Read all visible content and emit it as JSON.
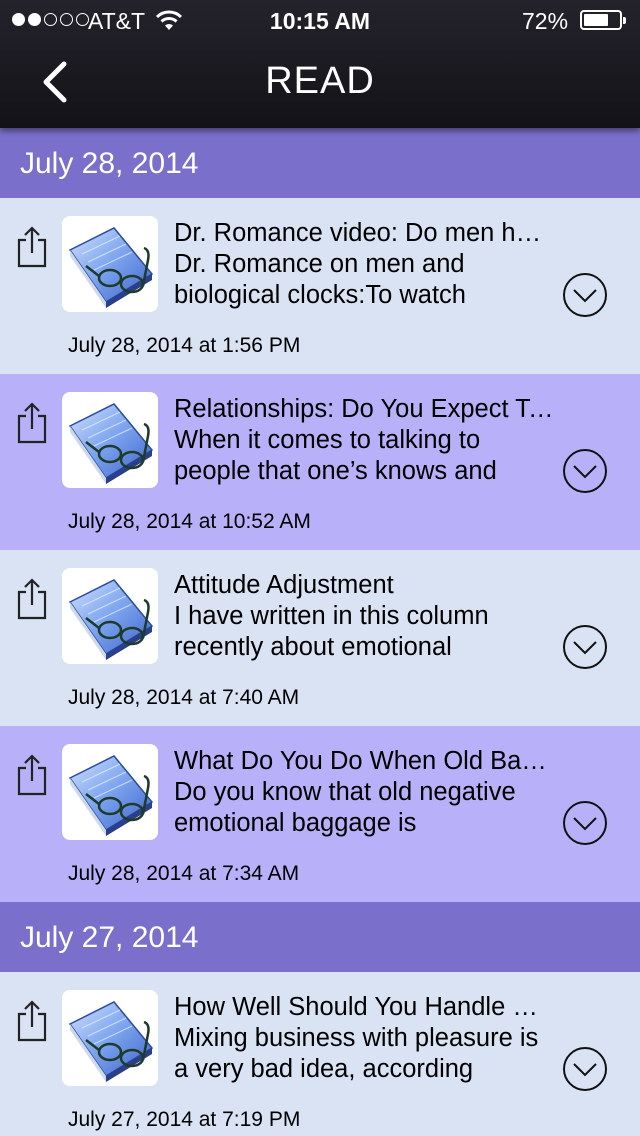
{
  "status_bar": {
    "carrier": "AT&T",
    "time": "10:15 AM",
    "battery": "72%",
    "battery_level": 0.72,
    "icons": [
      "signal-dots",
      "wifi-icon",
      "battery-icon"
    ]
  },
  "nav": {
    "title": "READ",
    "back_icon": "chevron-left-icon"
  },
  "colors": {
    "nav_bar": "#1b1a21",
    "date_header": "#7a6fcb",
    "row_light": "#d9e3f3",
    "row_purple": "#b8b0f9"
  },
  "sections": [
    {
      "date": "July 28, 2014",
      "items": [
        {
          "title": "Dr. Romance video: Do men have a biological clock?",
          "excerpt": "Dr. Romance on men and biological clocks:To watch",
          "timestamp": "July 28, 2014 at 1:56 PM"
        },
        {
          "title": "Relationships: Do You Expect Too Much?",
          "excerpt": "When it comes to talking to people that one’s knows and",
          "timestamp": "July 28, 2014 at 10:52 AM"
        },
        {
          "title": "Attitude Adjustment",
          "excerpt": "I have written in this column recently about emotional",
          "timestamp": "July 28, 2014 at 7:40 AM"
        },
        {
          "title": "What Do You Do When Old Baggage Returns?",
          "excerpt": "Do you know that old negative emotional baggage is",
          "timestamp": "July 28, 2014 at 7:34 AM"
        }
      ]
    },
    {
      "date": "July 27, 2014",
      "items": [
        {
          "title": "How Well Should You Handle Office Romance?",
          "excerpt": "Mixing business with pleasure is a very bad idea, according",
          "timestamp": "July 27, 2014 at 7:19 PM"
        }
      ]
    }
  ],
  "item_icons": [
    "share-icon",
    "book-thumbnail",
    "chevron-down-circle-icon"
  ]
}
